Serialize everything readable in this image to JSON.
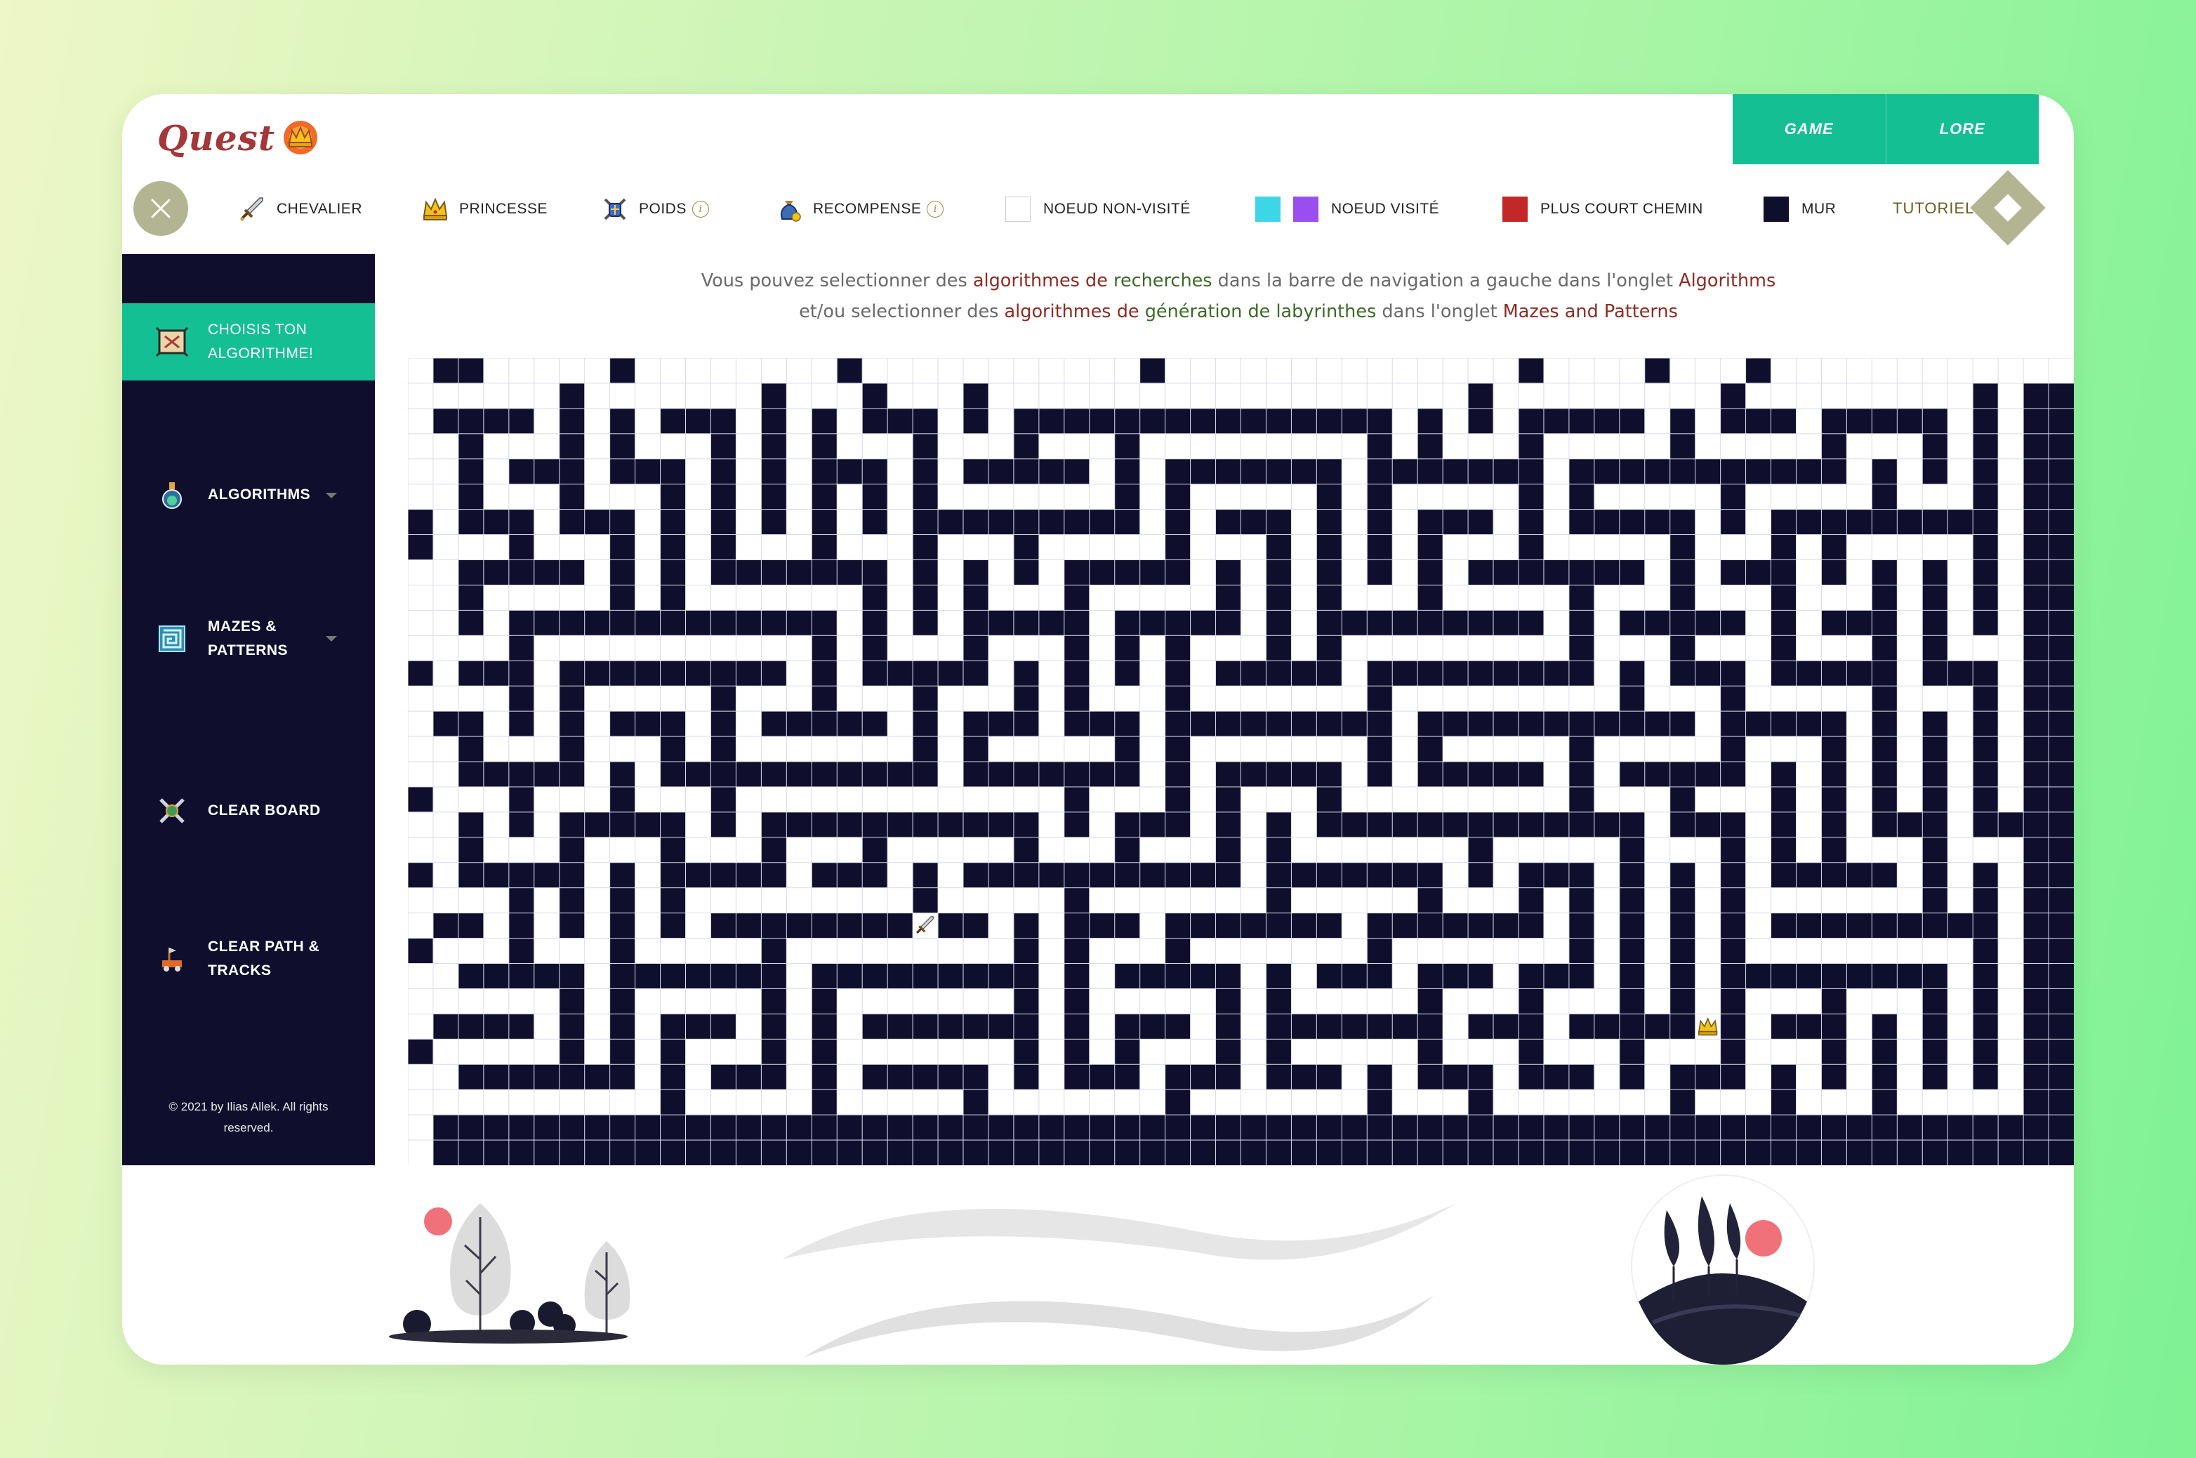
{
  "app": {
    "logo_text": "Quest"
  },
  "topnav": {
    "game": "GAME",
    "lore": "LORE"
  },
  "legend": {
    "chevalier": "CHEVALIER",
    "princesse": "PRINCESSE",
    "poids": "POIDS",
    "recompense": "RECOMPENSE",
    "noeud_non_visite": "NOEUD NON-VISITÉ",
    "noeud_visite": "NOEUD VISITÉ",
    "plus_court_chemin": "PLUS COURT CHEMIN",
    "mur": "MUR",
    "tutoriel": "TUTORIEL",
    "info_glyph": "i"
  },
  "colors": {
    "accent": "#14bf94",
    "sidebar": "#0f0f2d",
    "wall": "#0f0f2d",
    "visited_1": "#3cd6e6",
    "visited_2": "#9b4ef0",
    "shortest_path": "#c22828",
    "unvisited": "#ffffff"
  },
  "sidebar": {
    "choose_line1": "CHOISIS TON",
    "choose_line2": "ALGORITHME!",
    "algorithms": "ALGORITHMS",
    "mazes_line1": "MAZES &",
    "mazes_line2": "PATTERNS",
    "clear_board": "CLEAR BOARD",
    "clear_path_line1": "CLEAR PATH &",
    "clear_path_line2": "TRACKS",
    "copyright_line1": "© 2021 by Ilias Allek. All rights",
    "copyright_line2": "reserved."
  },
  "instructions": {
    "l1_a": "Vous pouvez selectionner des ",
    "l1_b": "algorithmes de ",
    "l1_c": "recherches",
    "l1_d": " dans la barre de navigation a gauche dans l'onglet ",
    "l1_e": "Algorithms",
    "l2_a": "et/ou selectionner des ",
    "l2_b": "algorithmes de ",
    "l2_c": "génération de labyrinthes",
    "l2_d": " dans l'onglet ",
    "l2_e": "Mazes and Patterns"
  },
  "board": {
    "rows": 32,
    "cols": 66,
    "knight": {
      "row": 22,
      "col": 20
    },
    "princess": {
      "row": 26,
      "col": 51
    }
  }
}
